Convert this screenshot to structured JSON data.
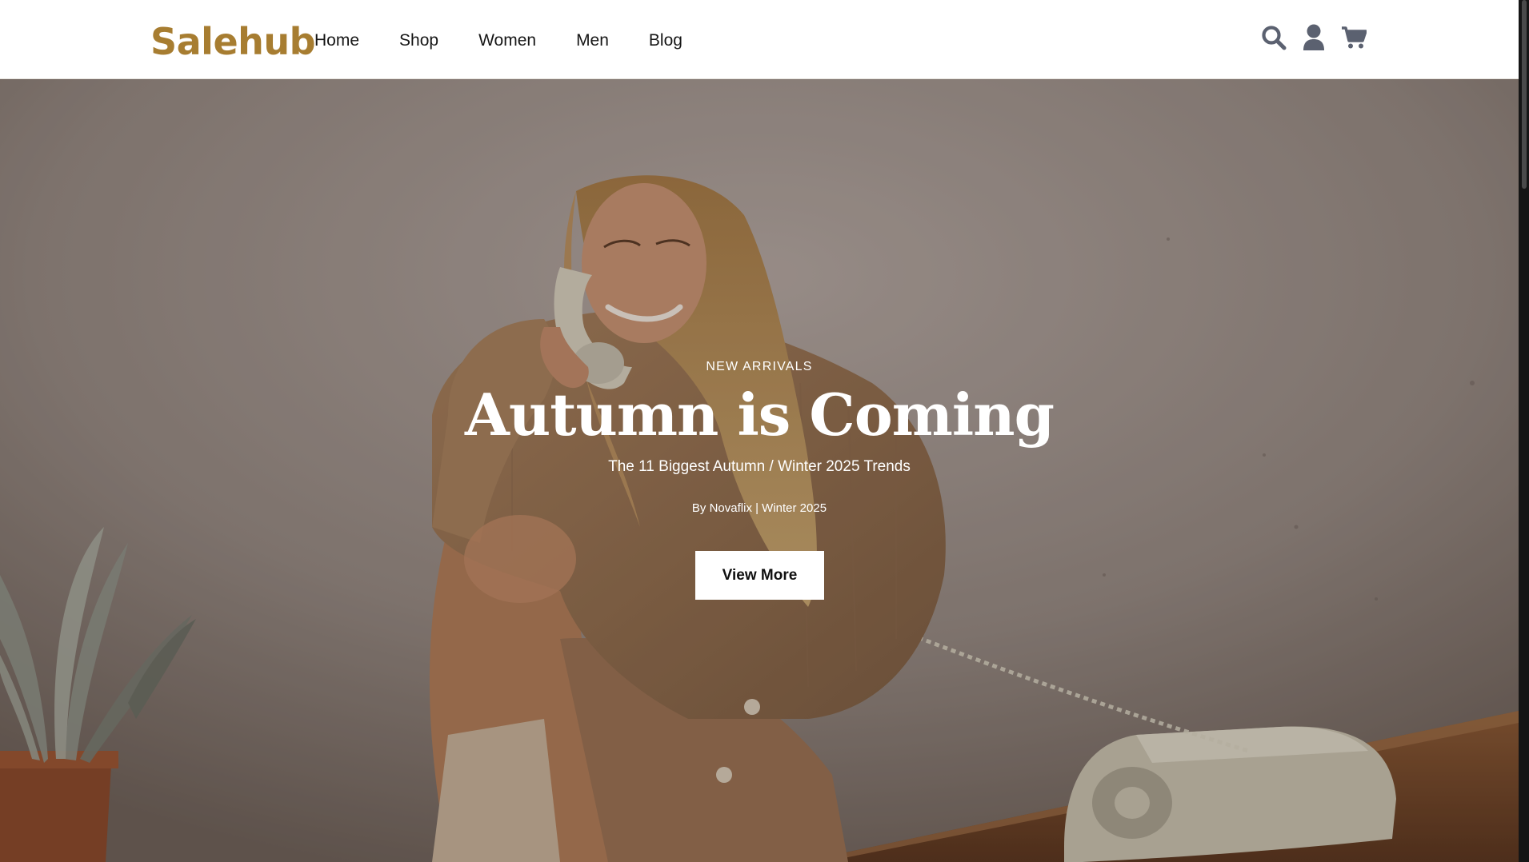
{
  "brand": {
    "logo_text": "Salehub",
    "logo_color": "#a77d31"
  },
  "nav": {
    "items": [
      {
        "label": "Home"
      },
      {
        "label": "Shop"
      },
      {
        "label": "Women"
      },
      {
        "label": "Men"
      },
      {
        "label": "Blog"
      }
    ]
  },
  "header_icons": [
    {
      "icon": "search-icon"
    },
    {
      "icon": "user-icon"
    },
    {
      "icon": "cart-icon"
    }
  ],
  "hero": {
    "eyebrow": "NEW ARRIVALS",
    "title": "Autumn is Coming",
    "subtitle": "The 11 Biggest Autumn / Winter 2025 Trends",
    "byline": "By Novaflix | Winter 2025",
    "cta_label": "View More"
  },
  "colors": {
    "icon_gray": "#5b6170",
    "header_bg": "#ffffff",
    "text_dark": "#161616"
  }
}
